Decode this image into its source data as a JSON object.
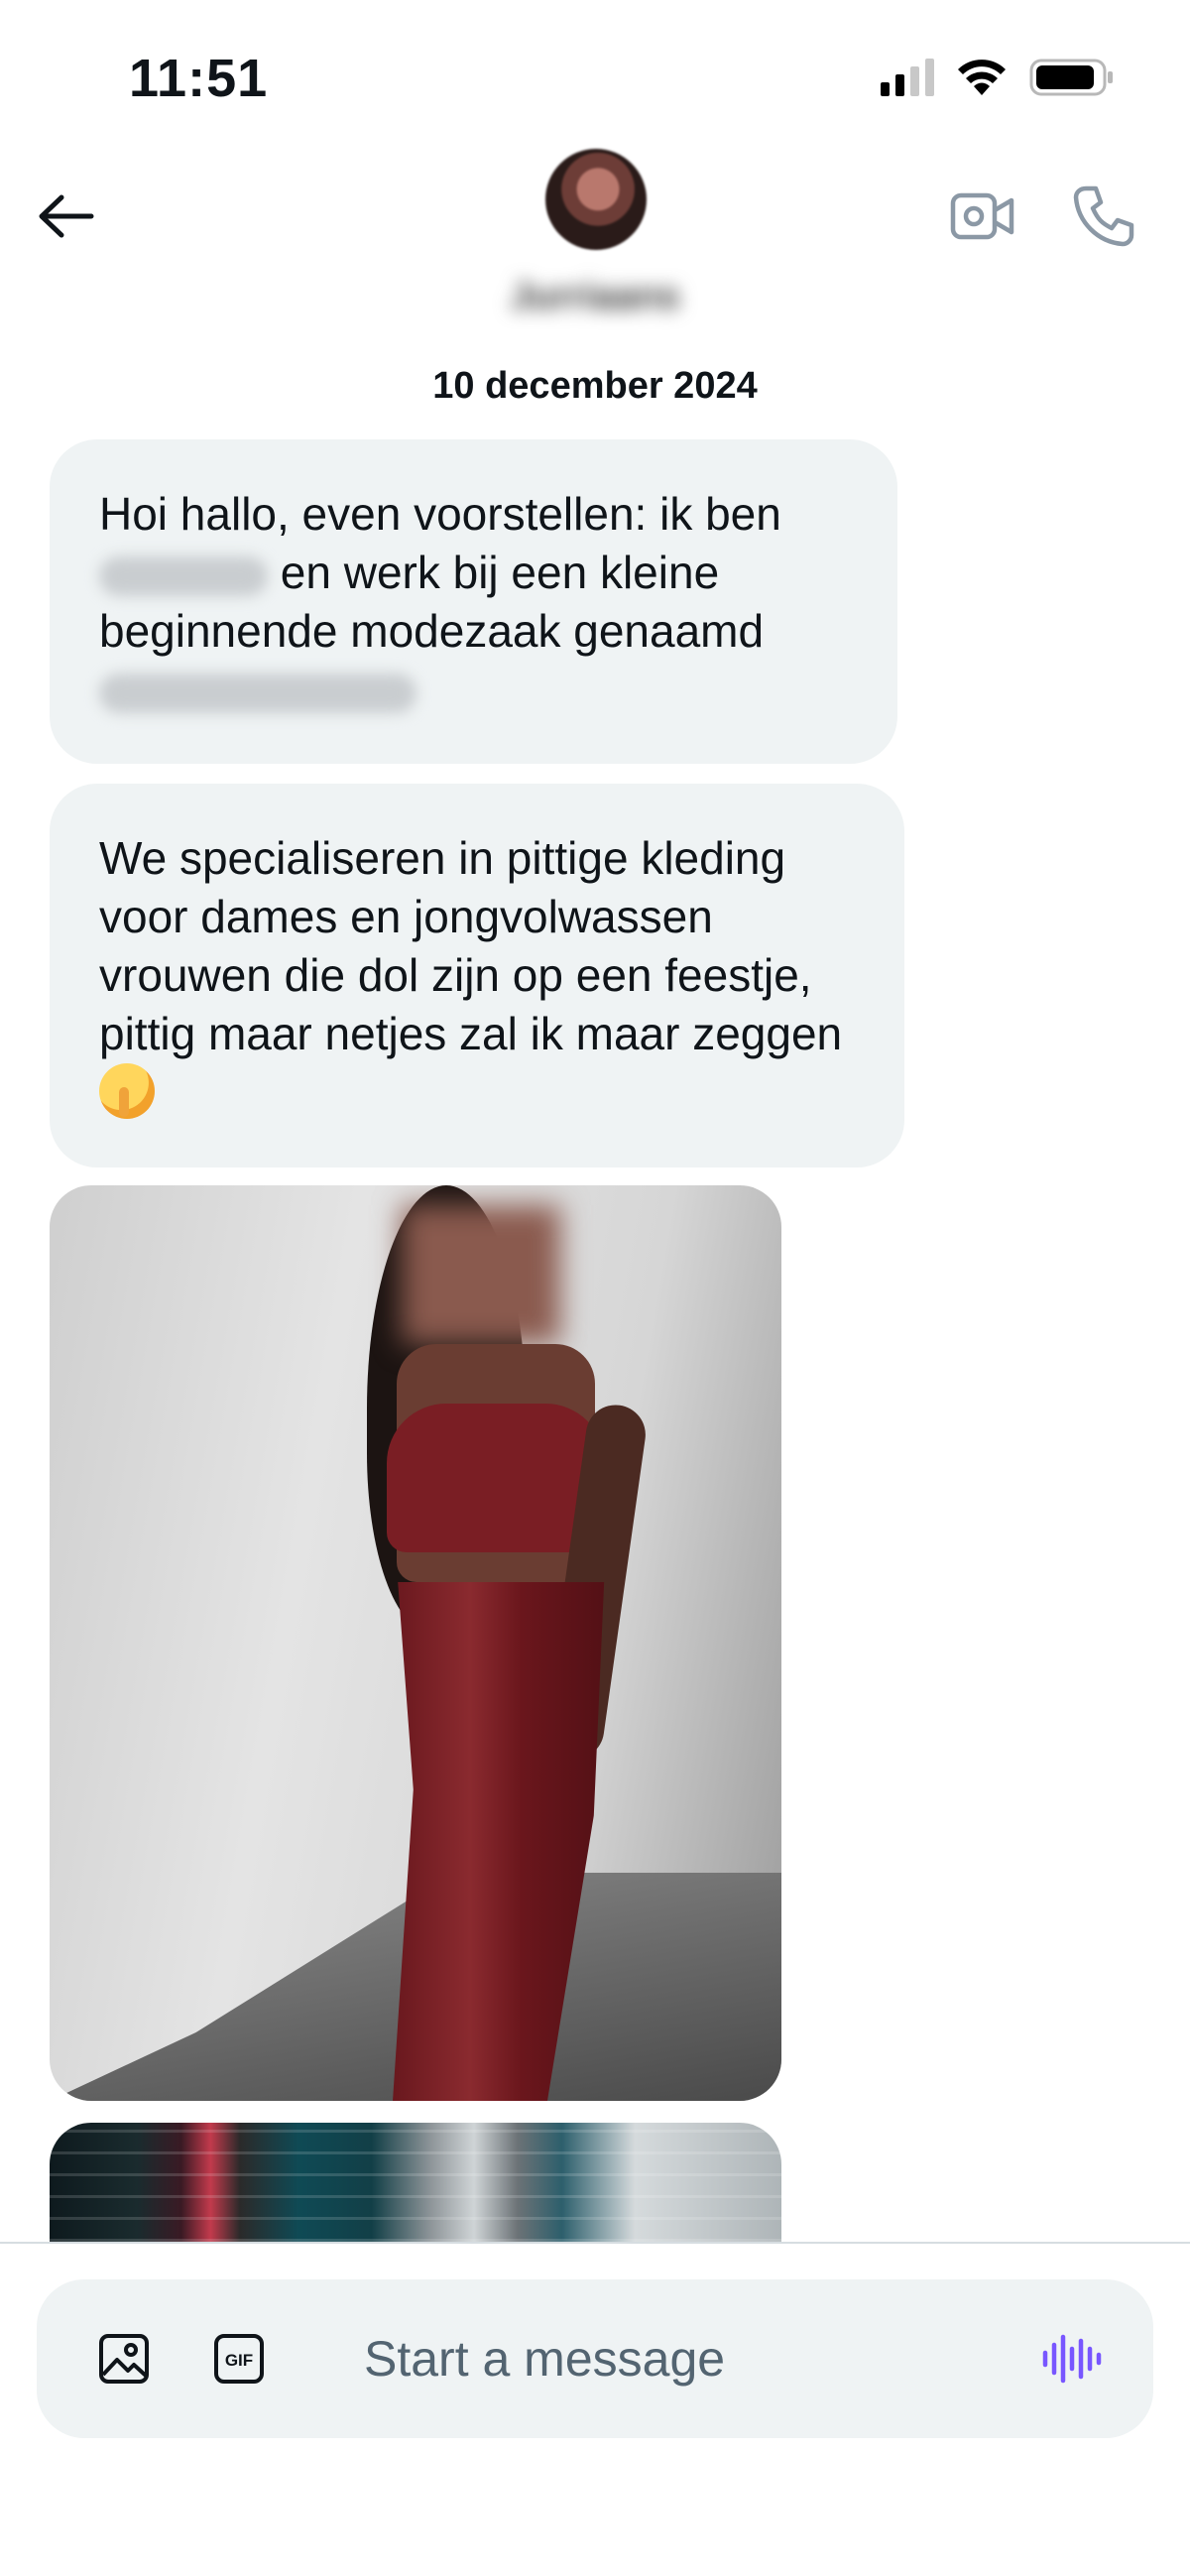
{
  "status_bar": {
    "time": "11:51"
  },
  "conversation": {
    "contact_name": "Jurriaans",
    "date": "10 december 2024",
    "messages": [
      {
        "part1": "Hoi hallo, even voorstellen: ik ben",
        "part2": "en werk bij een kleine beginnende modezaak genaamd"
      },
      {
        "text": "We specialiseren in pittige kleding voor dames en jongvolwassen vrouwen die dol zijn op een feestje, pittig maar netjes zal ik maar zeggen"
      }
    ]
  },
  "composer": {
    "placeholder": "Start a message"
  },
  "icons": {
    "back": "arrow-left-icon",
    "video": "video-camera-icon",
    "call": "phone-icon",
    "image": "image-icon",
    "gif": "gif-icon",
    "voice": "voice-waveform-icon"
  },
  "colors": {
    "bubble": "#eff3f4",
    "accent": "#7856ff",
    "text": "#0f1419",
    "muted": "#536471"
  }
}
